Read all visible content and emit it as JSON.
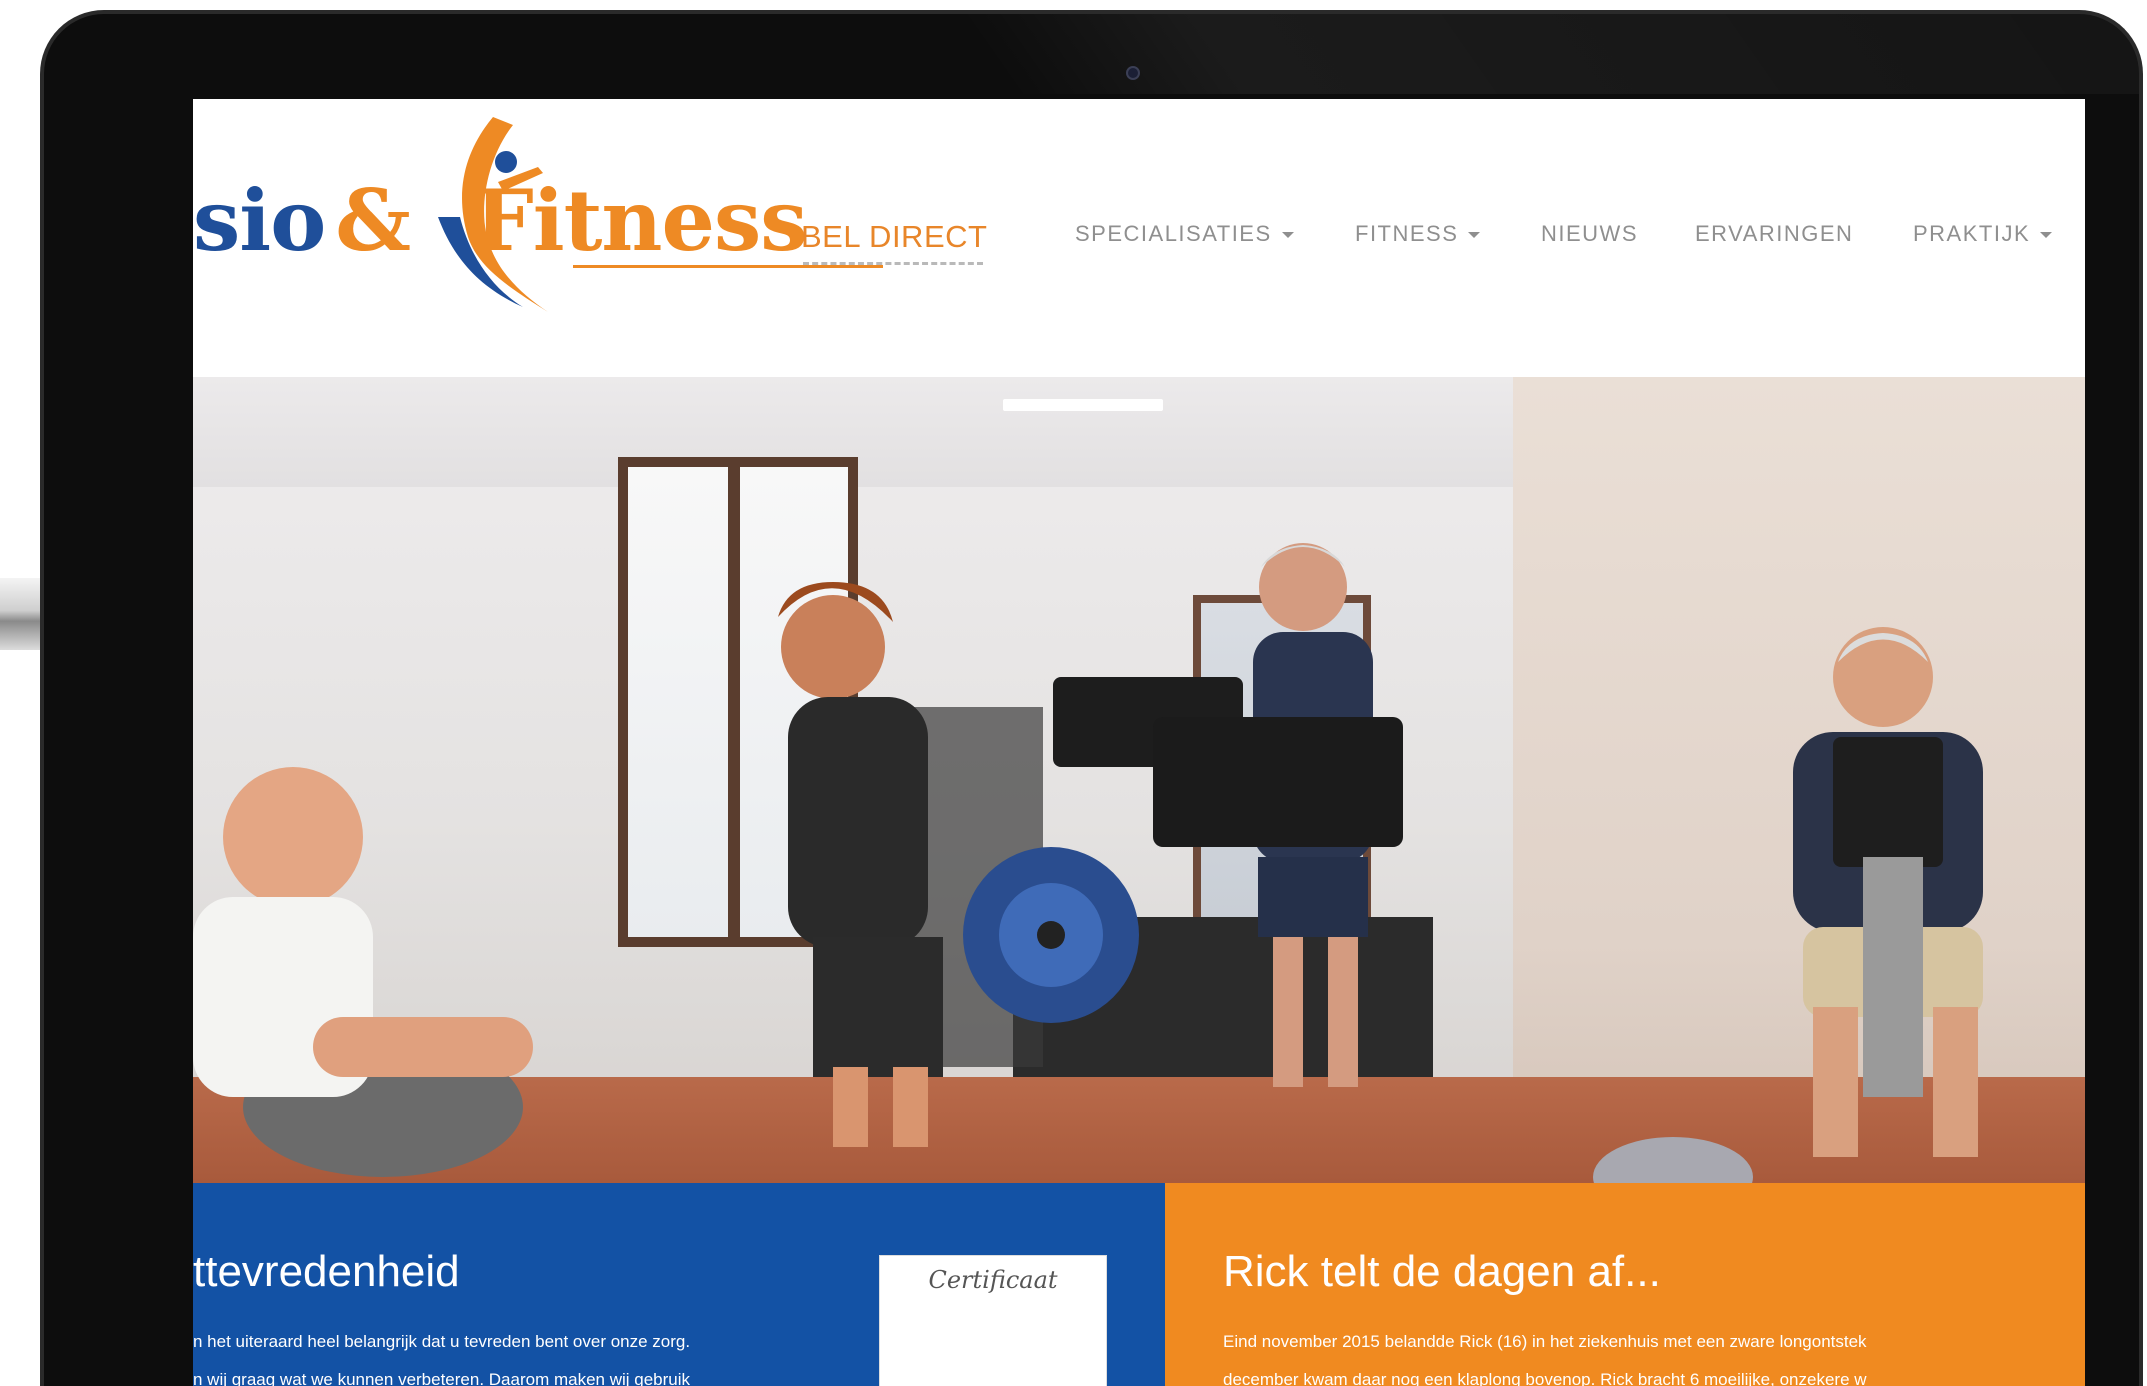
{
  "logo": {
    "text_part1": "sio",
    "ampersand": "&",
    "text_part2": "Fitness",
    "colors": {
      "blue": "#1f4f9a",
      "orange": "#ee8a24"
    }
  },
  "header": {
    "bel_direct": "BEL DIRECT"
  },
  "nav": {
    "items": [
      {
        "label": "SPECIALISATIES",
        "has_dropdown": true
      },
      {
        "label": "FITNESS",
        "has_dropdown": true
      },
      {
        "label": "NIEUWS",
        "has_dropdown": false
      },
      {
        "label": "ERVARINGEN",
        "has_dropdown": false
      },
      {
        "label": "PRAKTIJK",
        "has_dropdown": true
      }
    ]
  },
  "hero": {
    "image_description": "gym-photo"
  },
  "panels": {
    "left": {
      "title": "ttevredenheid",
      "lines": [
        "n het uiteraard heel belangrijk dat u tevreden bent over onze zorg.",
        "n wij graag wat we kunnen verbeteren. Daarom maken wij gebruik"
      ],
      "certificate_label": "Certificaat",
      "color": "#1352a5"
    },
    "right": {
      "title": "Rick telt de dagen af...",
      "lines": [
        "Eind november 2015 belandde Rick (16) in het ziekenhuis met een zware longontstek",
        "december kwam daar nog een klaplong bovenop. Rick bracht 6 moeilijke, onzekere w"
      ],
      "color": "#f08a20"
    }
  }
}
